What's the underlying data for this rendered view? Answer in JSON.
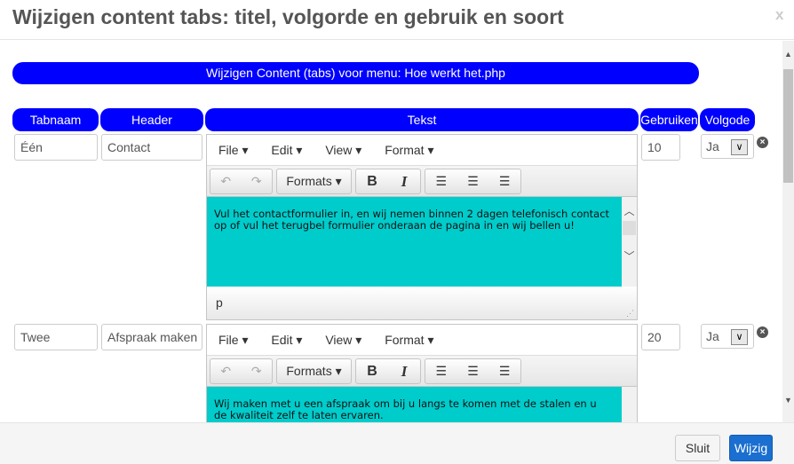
{
  "modal": {
    "title": "Wijzigen content tabs: titel, volgorde en gebruik en soort",
    "close_label": "x"
  },
  "banner": "Wijzigen Content (tabs) voor menu: Hoe werkt het.php",
  "columns": [
    "Tabnaam",
    "Header",
    "Tekst",
    "Gebruiken",
    "Volgode"
  ],
  "editor": {
    "menus": [
      "File",
      "Edit",
      "View",
      "Format"
    ],
    "formats_label": "Formats",
    "bold": "B",
    "italic": "I",
    "content_bg": "#00cccc"
  },
  "rows": [
    {
      "tabnaam": "Één",
      "header": "Contact",
      "tekst": "Vul het contactformulier in, en wij nemen binnen 2 dagen telefonisch contact op of vul het terugbel formulier onderaan de pagina in en wij bellen u!",
      "status": "p",
      "gebruiken": "10",
      "volgorde": "Ja"
    },
    {
      "tabnaam": "Twee",
      "header": "Afspraak maken",
      "tekst": "Wij maken met u een afspraak om bij u langs te komen met de stalen en u de kwaliteit zelf te laten ervaren.",
      "gebruiken": "20",
      "volgorde": "Ja"
    }
  ],
  "footer": {
    "close_label": "Sluit",
    "save_label": "Wijzig",
    "save_color": "#1a6fd0",
    "header_color": "#0000ff"
  }
}
